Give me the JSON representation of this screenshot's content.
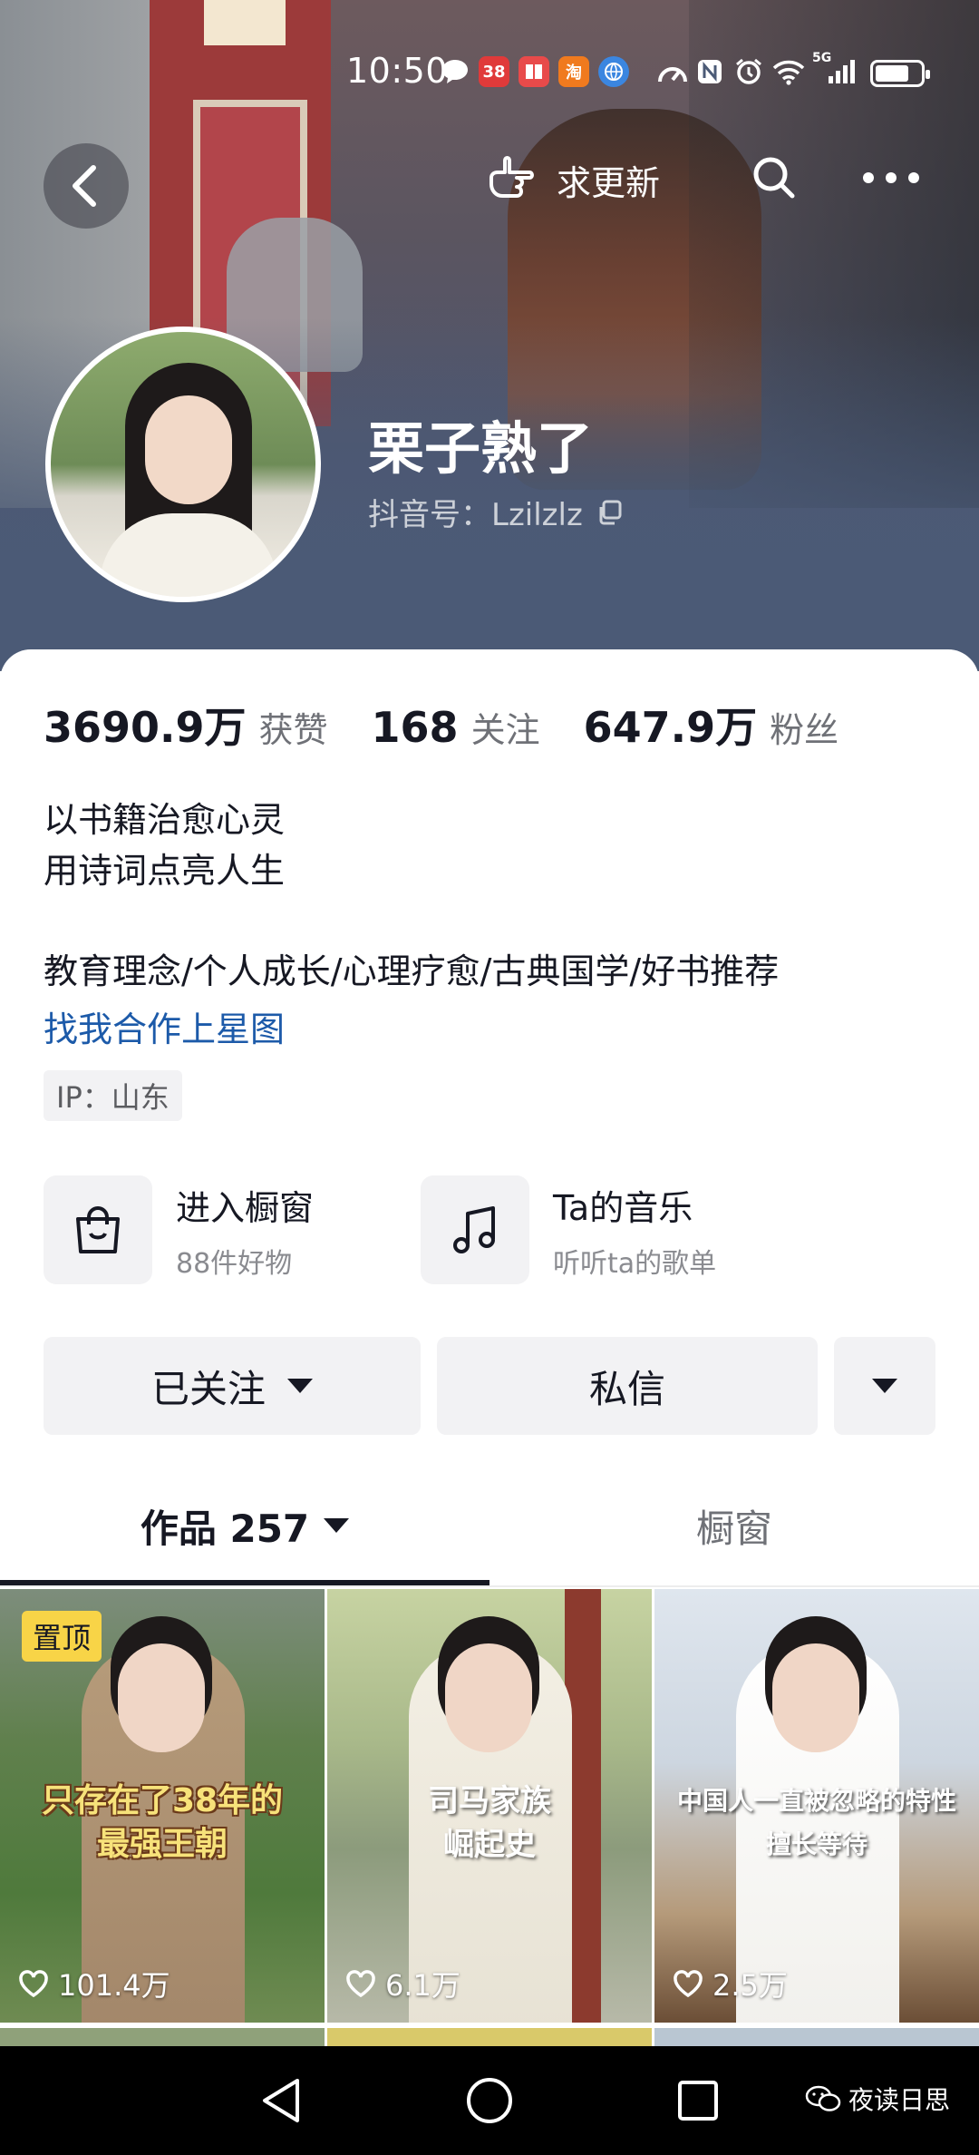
{
  "status_bar": {
    "time": "10:50",
    "app_icons": [
      "chat-bubble-icon",
      "badge-app-icon",
      "red-book-icon",
      "taobao-icon",
      "globe-app-icon"
    ],
    "app_icon_labels": [
      "",
      "38",
      "",
      "淘",
      ""
    ],
    "system_icons": [
      "speedometer-icon",
      "nfc-icon",
      "alarm-icon",
      "wifi-icon",
      "signal-5g-icon",
      "battery-icon"
    ],
    "network": "5G"
  },
  "top_nav": {
    "update_label": "求更新",
    "icons": {
      "back": "chevron-left-icon",
      "update": "hand-point-icon",
      "search": "search-icon",
      "more": "more-dots-icon"
    }
  },
  "profile": {
    "nickname": "栗子熟了",
    "douyin_id": "抖音号：Lzilzlz",
    "stats": [
      {
        "value": "3690.9万",
        "label": "获赞"
      },
      {
        "value": "168",
        "label": "关注"
      },
      {
        "value": "647.9万",
        "label": "粉丝"
      }
    ],
    "bio_lines": [
      "以书籍治愈心灵",
      "用诗词点亮人生"
    ],
    "tags": "教育理念/个人成长/心理疗愈/古典国学/好书推荐",
    "link": "找我合作上星图",
    "ip": "IP：山东"
  },
  "services": [
    {
      "title": "进入橱窗",
      "subtitle": "88件好物",
      "icon": "shopping-bag-icon"
    },
    {
      "title": "Ta的音乐",
      "subtitle": "听听ta的歌单",
      "icon": "music-note-icon"
    }
  ],
  "actions": {
    "followed": "已关注",
    "message": "私信"
  },
  "tabs": [
    {
      "label": "作品 257",
      "active": true
    },
    {
      "label": "橱窗",
      "active": false
    }
  ],
  "videos": [
    {
      "pinned_label": "置顶",
      "caption": "只存在了38年的\n最强王朝",
      "likes": "101.4万",
      "caption_color": "#f7e27a"
    },
    {
      "pinned_label": "",
      "caption": "司马家族\n崛起史",
      "likes": "6.1万",
      "caption_color": "#ffffff"
    },
    {
      "pinned_label": "",
      "caption": "中国人一直被忽略的特性\n擅长等待",
      "likes": "2.5万",
      "caption_color": "#ffffff"
    }
  ],
  "nav_bar": {
    "icons": [
      "back-triangle-icon",
      "home-circle-icon",
      "recents-square-icon"
    ],
    "watermark": "夜读日思"
  },
  "colors": {
    "accent_link": "#1c5aa9",
    "pin_badge": "#f8d447",
    "text_primary": "#161823"
  }
}
